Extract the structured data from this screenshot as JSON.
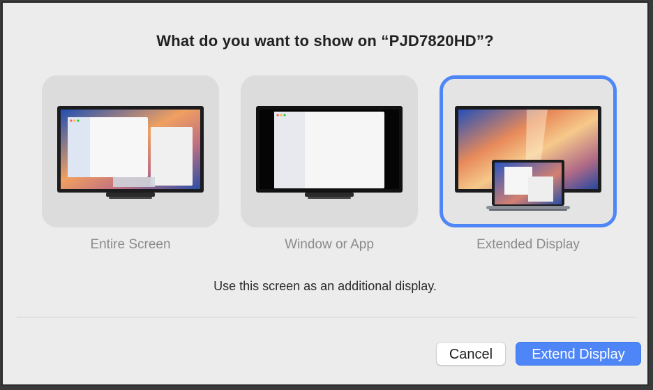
{
  "dialog": {
    "title": "What do you want to show on “PJD7820HD”?",
    "description": "Use this screen as an additional display."
  },
  "options": [
    {
      "label": "Entire Screen",
      "selected": false
    },
    {
      "label": "Window or App",
      "selected": false
    },
    {
      "label": "Extended Display",
      "selected": true
    }
  ],
  "buttons": {
    "cancel_label": "Cancel",
    "primary_label": "Extend Display"
  },
  "colors": {
    "accent": "#4f86f7",
    "dialog_bg": "#ececec",
    "tile_bg": "#dcdcdc",
    "label_gray": "#8a8a8a"
  },
  "icons": [
    "monitor-mirror-icon",
    "monitor-window-icon",
    "monitor-extended-icon"
  ]
}
